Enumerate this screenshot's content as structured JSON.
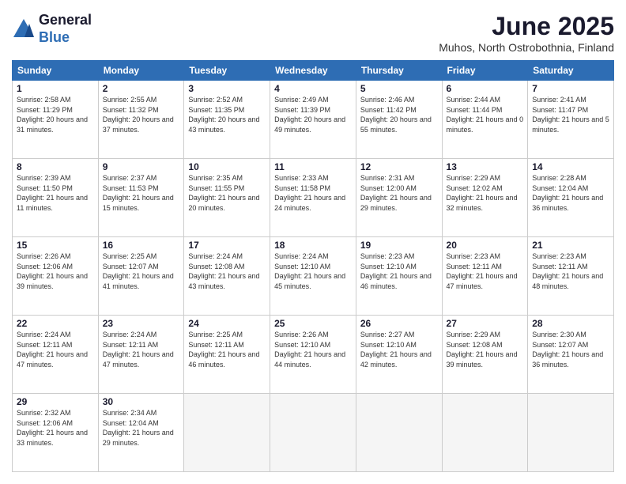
{
  "logo": {
    "general": "General",
    "blue": "Blue"
  },
  "header": {
    "month": "June 2025",
    "location": "Muhos, North Ostrobothnia, Finland"
  },
  "weekdays": [
    "Sunday",
    "Monday",
    "Tuesday",
    "Wednesday",
    "Thursday",
    "Friday",
    "Saturday"
  ],
  "weeks": [
    [
      {
        "day": "1",
        "sunrise": "2:58 AM",
        "sunset": "11:29 PM",
        "daylight": "Daylight: 20 hours and 31 minutes."
      },
      {
        "day": "2",
        "sunrise": "2:55 AM",
        "sunset": "11:32 PM",
        "daylight": "Daylight: 20 hours and 37 minutes."
      },
      {
        "day": "3",
        "sunrise": "2:52 AM",
        "sunset": "11:35 PM",
        "daylight": "Daylight: 20 hours and 43 minutes."
      },
      {
        "day": "4",
        "sunrise": "2:49 AM",
        "sunset": "11:39 PM",
        "daylight": "Daylight: 20 hours and 49 minutes."
      },
      {
        "day": "5",
        "sunrise": "2:46 AM",
        "sunset": "11:42 PM",
        "daylight": "Daylight: 20 hours and 55 minutes."
      },
      {
        "day": "6",
        "sunrise": "2:44 AM",
        "sunset": "11:44 PM",
        "daylight": "Daylight: 21 hours and 0 minutes."
      },
      {
        "day": "7",
        "sunrise": "2:41 AM",
        "sunset": "11:47 PM",
        "daylight": "Daylight: 21 hours and 5 minutes."
      }
    ],
    [
      {
        "day": "8",
        "sunrise": "2:39 AM",
        "sunset": "11:50 PM",
        "daylight": "Daylight: 21 hours and 11 minutes."
      },
      {
        "day": "9",
        "sunrise": "2:37 AM",
        "sunset": "11:53 PM",
        "daylight": "Daylight: 21 hours and 15 minutes."
      },
      {
        "day": "10",
        "sunrise": "2:35 AM",
        "sunset": "11:55 PM",
        "daylight": "Daylight: 21 hours and 20 minutes."
      },
      {
        "day": "11",
        "sunrise": "2:33 AM",
        "sunset": "11:58 PM",
        "daylight": "Daylight: 21 hours and 24 minutes."
      },
      {
        "day": "12",
        "sunrise": "2:31 AM",
        "sunset": "12:00 AM",
        "daylight": "Daylight: 21 hours and 29 minutes."
      },
      {
        "day": "13",
        "sunrise": "2:29 AM",
        "sunset": "12:02 AM",
        "daylight": "Daylight: 21 hours and 32 minutes."
      },
      {
        "day": "14",
        "sunrise": "2:28 AM",
        "sunset": "12:04 AM",
        "daylight": "Daylight: 21 hours and 36 minutes."
      }
    ],
    [
      {
        "day": "15",
        "sunrise": "2:26 AM",
        "sunset": "12:06 AM",
        "daylight": "Daylight: 21 hours and 39 minutes."
      },
      {
        "day": "16",
        "sunrise": "2:25 AM",
        "sunset": "12:07 AM",
        "daylight": "Daylight: 21 hours and 41 minutes."
      },
      {
        "day": "17",
        "sunrise": "2:24 AM",
        "sunset": "12:08 AM",
        "daylight": "Daylight: 21 hours and 43 minutes."
      },
      {
        "day": "18",
        "sunrise": "2:24 AM",
        "sunset": "12:10 AM",
        "daylight": "Daylight: 21 hours and 45 minutes."
      },
      {
        "day": "19",
        "sunrise": "2:23 AM",
        "sunset": "12:10 AM",
        "daylight": "Daylight: 21 hours and 46 minutes."
      },
      {
        "day": "20",
        "sunrise": "2:23 AM",
        "sunset": "12:11 AM",
        "daylight": "Daylight: 21 hours and 47 minutes."
      },
      {
        "day": "21",
        "sunrise": "2:23 AM",
        "sunset": "12:11 AM",
        "daylight": "Daylight: 21 hours and 48 minutes."
      }
    ],
    [
      {
        "day": "22",
        "sunrise": "2:24 AM",
        "sunset": "12:11 AM",
        "daylight": "Daylight: 21 hours and 47 minutes."
      },
      {
        "day": "23",
        "sunrise": "2:24 AM",
        "sunset": "12:11 AM",
        "daylight": "Daylight: 21 hours and 47 minutes."
      },
      {
        "day": "24",
        "sunrise": "2:25 AM",
        "sunset": "12:11 AM",
        "daylight": "Daylight: 21 hours and 46 minutes."
      },
      {
        "day": "25",
        "sunrise": "2:26 AM",
        "sunset": "12:10 AM",
        "daylight": "Daylight: 21 hours and 44 minutes."
      },
      {
        "day": "26",
        "sunrise": "2:27 AM",
        "sunset": "12:10 AM",
        "daylight": "Daylight: 21 hours and 42 minutes."
      },
      {
        "day": "27",
        "sunrise": "2:29 AM",
        "sunset": "12:08 AM",
        "daylight": "Daylight: 21 hours and 39 minutes."
      },
      {
        "day": "28",
        "sunrise": "2:30 AM",
        "sunset": "12:07 AM",
        "daylight": "Daylight: 21 hours and 36 minutes."
      }
    ],
    [
      {
        "day": "29",
        "sunrise": "2:32 AM",
        "sunset": "12:06 AM",
        "daylight": "Daylight: 21 hours and 33 minutes."
      },
      {
        "day": "30",
        "sunrise": "2:34 AM",
        "sunset": "12:04 AM",
        "daylight": "Daylight: 21 hours and 29 minutes."
      },
      null,
      null,
      null,
      null,
      null
    ]
  ]
}
